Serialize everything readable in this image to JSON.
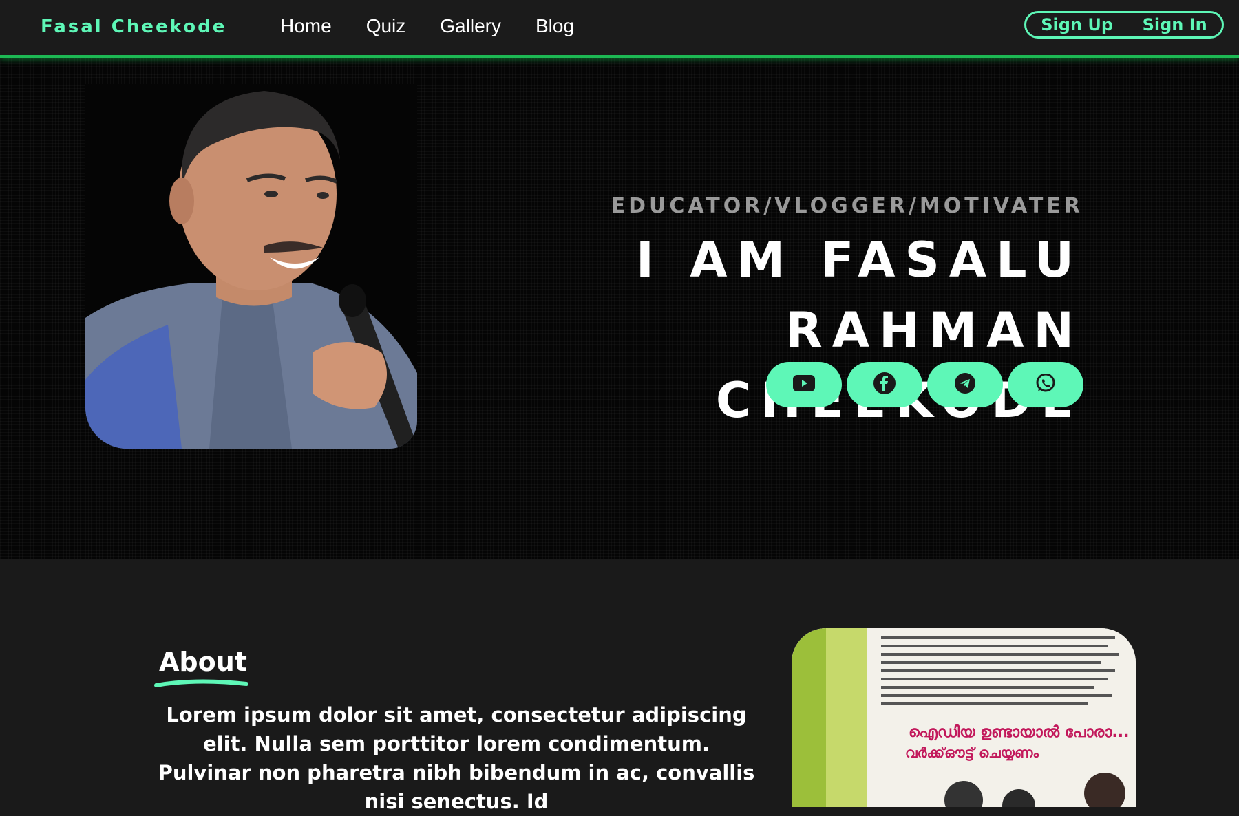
{
  "header": {
    "brand": "Fasal Cheekode",
    "nav": [
      "Home",
      "Quiz",
      "Gallery",
      "Blog"
    ],
    "sign_up": "Sign Up",
    "sign_in": "Sign In"
  },
  "hero": {
    "subtitle": "EDUCATOR/VLOGGER/MOTIVATER",
    "headline": "I AM FASALU RAHMAN CHEEKODE",
    "socials": [
      "youtube-icon",
      "facebook-icon",
      "telegram-icon",
      "whatsapp-icon"
    ]
  },
  "about": {
    "title": "About",
    "text": "Lorem ipsum dolor sit amet, consectetur adipiscing elit. Nulla sem porttitor lorem condimentum. Pulvinar non pharetra nibh bibendum in ac, convallis nisi senectus. Id",
    "image_caption_1": "ഐഡിയ ഉണ്ടായാൽ പോരാ...",
    "image_caption_2": "വർക്ക്ഔട്ട് ചെയ്യണം"
  },
  "colors": {
    "accent": "#5ef7b7",
    "accent_line": "#1db954",
    "background": "#1a1a1a"
  }
}
